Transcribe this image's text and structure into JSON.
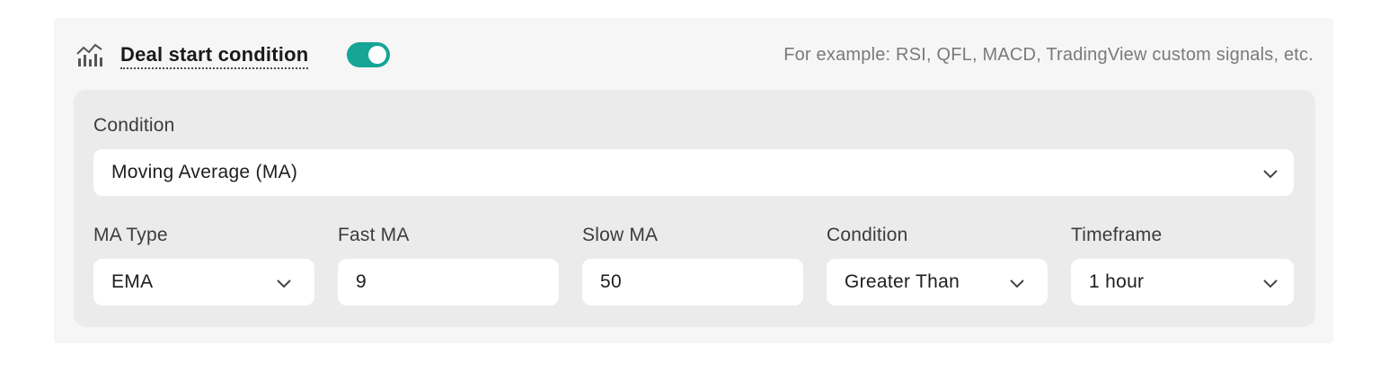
{
  "header": {
    "title": "Deal start condition",
    "toggle_on": true,
    "hint": "For example: RSI, QFL, MACD, TradingView custom signals, etc.",
    "icon": "chart-bars-icon",
    "accent_color": "#16a596"
  },
  "condition": {
    "label": "Condition",
    "value": "Moving Average (MA)"
  },
  "fields": [
    {
      "label": "MA Type",
      "value": "EMA",
      "type": "select"
    },
    {
      "label": "Fast MA",
      "value": "9",
      "type": "input"
    },
    {
      "label": "Slow MA",
      "value": "50",
      "type": "input"
    },
    {
      "label": "Condition",
      "value": "Greater Than",
      "type": "select"
    },
    {
      "label": "Timeframe",
      "value": "1 hour",
      "type": "select"
    }
  ]
}
